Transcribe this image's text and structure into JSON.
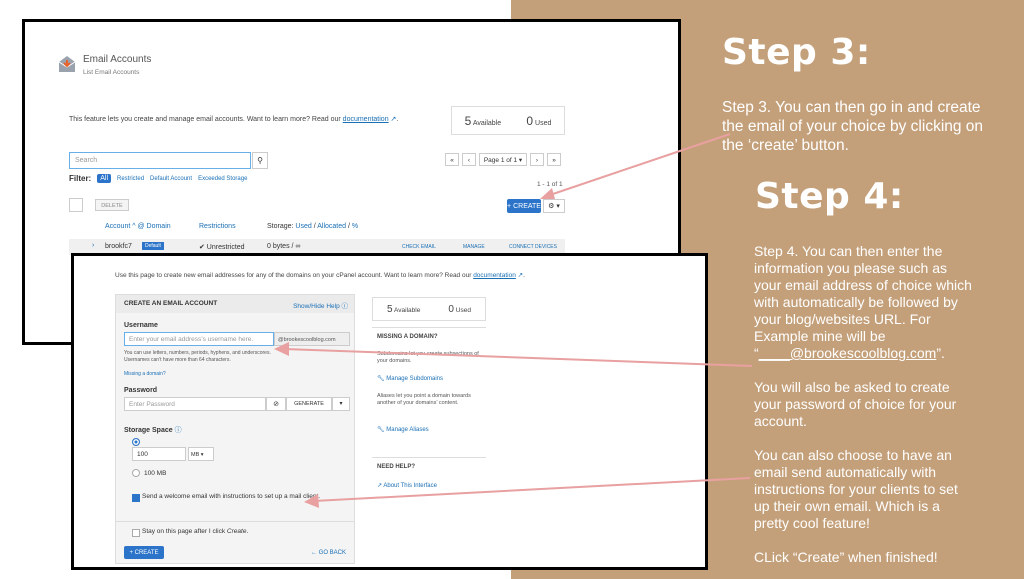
{
  "right": {
    "step3_title": "Step 3:",
    "step3_body": "Step 3. You can then go in and create the email of your choice by clicking on the ‘create’ button.",
    "step4_title": "Step 4:",
    "step4_p1_pre": "Step 4. You can then enter the information you please such as your email address of choice which with automatically be followed by your blog/websites URL. For Example mine will be “",
    "step4_p1_link": "____@brookescoolblog.com",
    "step4_p1_post": "”.",
    "step4_p2": "You will also be asked to create your password of choice for your account.",
    "step4_p3": "You can also choose to have an email send automatically with instructions for your clients to set up their own email. Which is a pretty cool feature!",
    "step4_p4": "CLick “Create” when finished!"
  },
  "top": {
    "title": "Email Accounts",
    "subtitle": "List Email Accounts",
    "intro": "This feature lets you create and manage email accounts. Want to learn more? Read our",
    "doc_link": "documentation",
    "intro_end": ".",
    "available_num": "5",
    "available_label": "Available",
    "used_num": "0",
    "used_label": "Used",
    "search_placeholder": "Search",
    "pager": {
      "first": "«",
      "prev": "‹",
      "page": "Page 1 of 1 ▾",
      "next": "›",
      "last": "»"
    },
    "filter_label": "Filter:",
    "filters": [
      "All",
      "Restricted",
      "Default Account",
      "Exceeded Storage"
    ],
    "count": "1 - 1 of 1",
    "delete_label": "DELETE",
    "create_label": "+ CREATE",
    "gear": "⚙ ▾",
    "col_account": "Account ^ @ Domain",
    "col_restrictions": "Restrictions",
    "col_storage_pre": "Storage:",
    "col_storage_used": "Used",
    "col_storage_alloc": "Allocated",
    "col_storage_pct": "%",
    "row_user": "brookfc7",
    "row_badge": "Default",
    "row_restriction": "✔ Unrestricted",
    "row_storage": "0 bytes / ∞",
    "row_actions": [
      "CHECK EMAIL",
      "MANAGE",
      "CONNECT DEVICES"
    ]
  },
  "bottom": {
    "intro": "Use this page to create new email addresses for any of the domains on your cPanel account. Want to learn more? Read our",
    "doc_link": "documentation",
    "intro_end": ".",
    "section_title": "CREATE AN EMAIL ACCOUNT",
    "show_hide": "Show/Hide Help",
    "username_label": "Username",
    "username_placeholder": "Enter your email address’s username here.",
    "domain_suffix": "@brookescoolblog.com",
    "username_help": "You can use letters, numbers, periods, hyphens, and underscores. Usernames can’t have more than 64 characters.",
    "missing_domain_link": "Missing a domain?",
    "password_label": "Password",
    "password_placeholder": "Enter Password",
    "generate_label": "GENERATE",
    "storage_label": "Storage Space",
    "storage_value": "100",
    "storage_unit": "MB ▾",
    "storage_option": "100 MB",
    "welcome_label": "Send a welcome email with instructions to set up a mail client.",
    "stay_label": "Stay on this page after I click",
    "stay_em": "Create",
    "create_label": "+ CREATE",
    "go_back": "← GO BACK",
    "side_available_num": "5",
    "side_available_label": "Available",
    "side_used_num": "0",
    "side_used_label": "Used",
    "missing_title": "MISSING A DOMAIN?",
    "missing_body": "Subdomains let you create subsections of your domains.",
    "manage_subdomains": "Manage Subdomains",
    "aliases_body": "Aliases let you point a domain towards another of your domains’ content.",
    "manage_aliases": "Manage Aliases",
    "help_title": "NEED HELP?",
    "about_link": "About This Interface"
  },
  "colors": {
    "panel": "#c4a07a",
    "accent_blue": "#2b74c9",
    "arrow": "#e8a0a0"
  }
}
